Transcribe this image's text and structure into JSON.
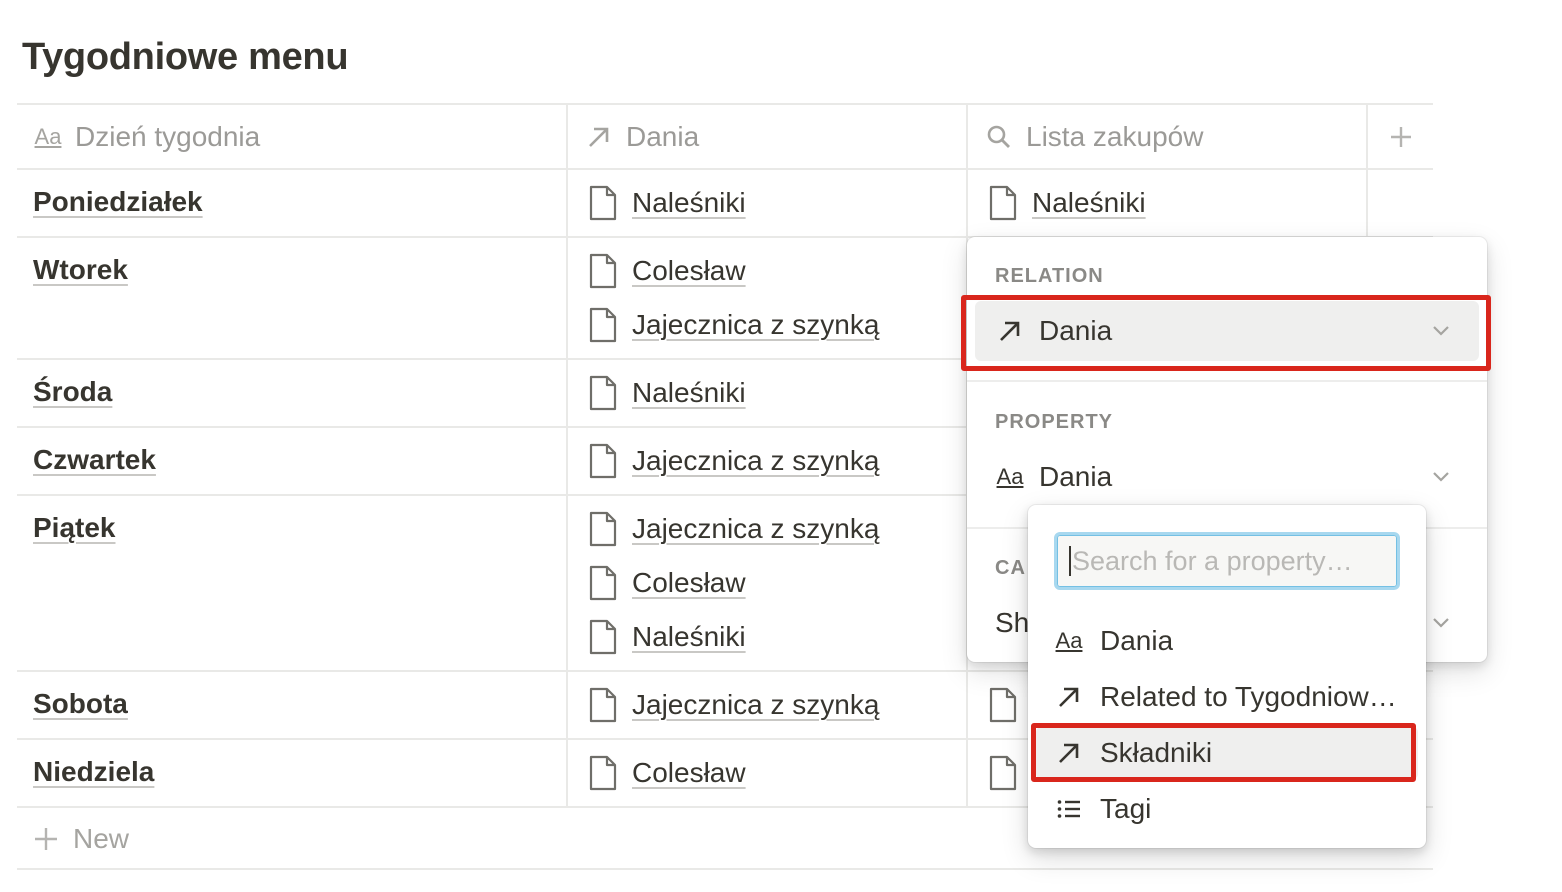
{
  "page": {
    "title": "Tygodniowe menu"
  },
  "table": {
    "headers": [
      {
        "label": "Dzień tygodnia",
        "icon": "text-aa-icon"
      },
      {
        "label": "Dania",
        "icon": "relation-arrow-icon"
      },
      {
        "label": "Lista zakupów",
        "icon": "search-icon"
      },
      {
        "label": "+",
        "icon": "plus-icon"
      }
    ],
    "rows": [
      {
        "day": "Poniedziałek",
        "dishes": [
          "Naleśniki"
        ],
        "list": [
          "Naleśniki"
        ]
      },
      {
        "day": "Wtorek",
        "dishes": [
          "Colesław",
          "Jajecznica z szynką"
        ],
        "list": []
      },
      {
        "day": "Środa",
        "dishes": [
          "Naleśniki"
        ],
        "list": []
      },
      {
        "day": "Czwartek",
        "dishes": [
          "Jajecznica z szynką"
        ],
        "list": []
      },
      {
        "day": "Piątek",
        "dishes": [
          "Jajecznica z szynką",
          "Colesław",
          "Naleśniki"
        ],
        "list": []
      },
      {
        "day": "Sobota",
        "dishes": [
          "Jajecznica z szynką"
        ],
        "list": []
      },
      {
        "day": "Niedziela",
        "dishes": [
          "Colesław"
        ],
        "list": []
      }
    ],
    "new_label": "New"
  },
  "rollup_popover": {
    "relation_label": "RELATION",
    "relation_value": "Dania",
    "property_label": "PROPERTY",
    "property_value": "Dania",
    "calculate_label_partial": "CA",
    "calculate_value_partial": "Sh"
  },
  "property_dropdown": {
    "search_placeholder": "Search for a property…",
    "options": [
      {
        "label": "Dania",
        "icon": "text-aa-icon"
      },
      {
        "label": "Related to Tygodniow…",
        "icon": "relation-arrow-icon"
      },
      {
        "label": "Składniki",
        "icon": "relation-arrow-icon",
        "highlighted": true
      },
      {
        "label": "Tagi",
        "icon": "list-icon"
      }
    ]
  },
  "colors": {
    "highlight_red": "#d9261c",
    "focus_blue": "#a8d8ef"
  }
}
